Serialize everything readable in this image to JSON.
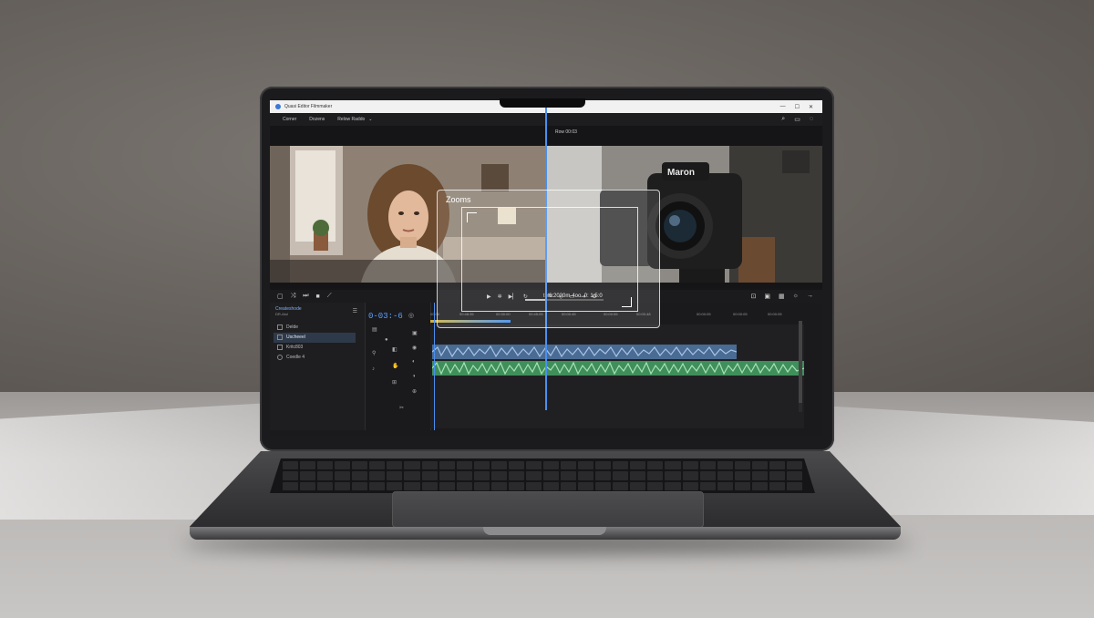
{
  "window": {
    "title": "Quasi Editor Filmmaker",
    "menu": [
      "Corner",
      "Dozens",
      "Relow Raddo"
    ],
    "controls": [
      "—",
      "☐",
      "✕"
    ]
  },
  "viewer": {
    "program_label": "Row 00:03",
    "zoom_panel": {
      "title": "Zooms",
      "readout": "6:2020m-4oo. 0: 1:5:0"
    }
  },
  "controls_bar": {
    "left_icons": [
      "stop-icon",
      "shuffle-icon",
      "skip-icon",
      "square-icon",
      "crop-icon"
    ],
    "center_label": "tetu",
    "right_icons": [
      "link-icon",
      "camera-icon",
      "grid-icon",
      "settings-icon",
      "arrow-right-icon"
    ]
  },
  "project": {
    "title": "Createshode",
    "subtitle": "DR-Alul",
    "items": [
      {
        "label": "Delde",
        "selected": false
      },
      {
        "label": "Uscheeel",
        "selected": true
      },
      {
        "label": "Kritc803",
        "selected": false
      },
      {
        "label": "Coedle 4",
        "selected": false
      }
    ]
  },
  "timeline": {
    "timecode": "0-03:-6",
    "ruler": [
      "00:00",
      "00:48:35",
      "00:30:00",
      "00:45:05",
      "00:00:45",
      "00:00:55",
      "00:00:48",
      "00:00:05",
      "00:00:05",
      "00:00:05",
      "00:00:05"
    ]
  },
  "colors": {
    "accent": "#4a8ff0",
    "audio_track_a": "#4a6b93",
    "audio_track_b": "#3f8f5a",
    "timecode": "#5ea0ff"
  }
}
